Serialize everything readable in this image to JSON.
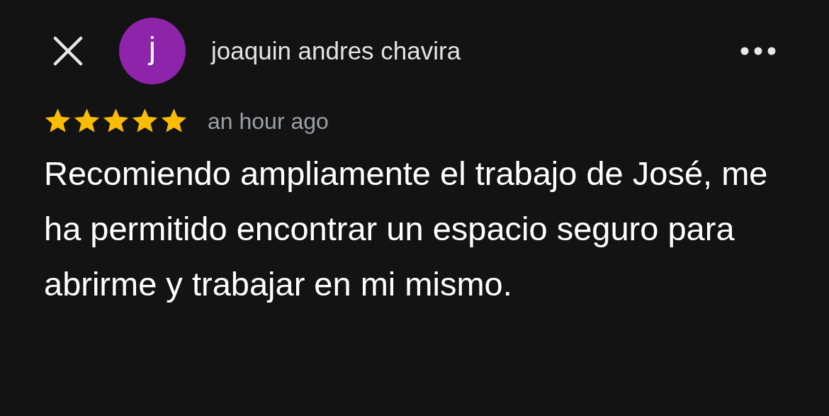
{
  "review": {
    "author": "joaquin andres chavira",
    "avatar_letter": "j",
    "stars": 5,
    "time": "an hour ago",
    "text": "Recomiendo ampliamente el trabajo de José, me ha permitido encontrar un espacio seguro para abrirme y trabajar en mi mismo."
  }
}
